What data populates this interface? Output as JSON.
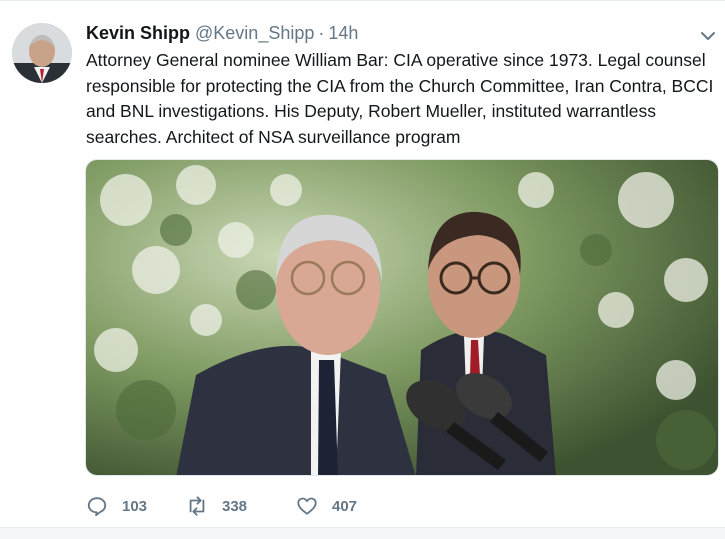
{
  "tweet": {
    "display_name": "Kevin Shipp",
    "handle": "@Kevin_Shipp",
    "separator": "·",
    "time": "14h",
    "text_lines": [
      "Attorney General nominee William Bar: CIA operative since 1973. Legal counsel",
      "responsible for protecting the CIA from the Church Committee, Iran Contra, BCCI",
      "and BNL investigations. His Deputy, Robert Mueller, instituted warrantless",
      "searches. Architect of NSA surveillance program"
    ],
    "actions": {
      "reply_count": "103",
      "retweet_count": "338",
      "like_count": "407"
    },
    "icons": {
      "reply": "reply-icon",
      "retweet": "retweet-icon",
      "like": "heart-icon",
      "caret": "chevron-down-icon"
    },
    "colors": {
      "text": "#14171a",
      "secondary": "#657786",
      "border": "#e6ecf0"
    }
  }
}
